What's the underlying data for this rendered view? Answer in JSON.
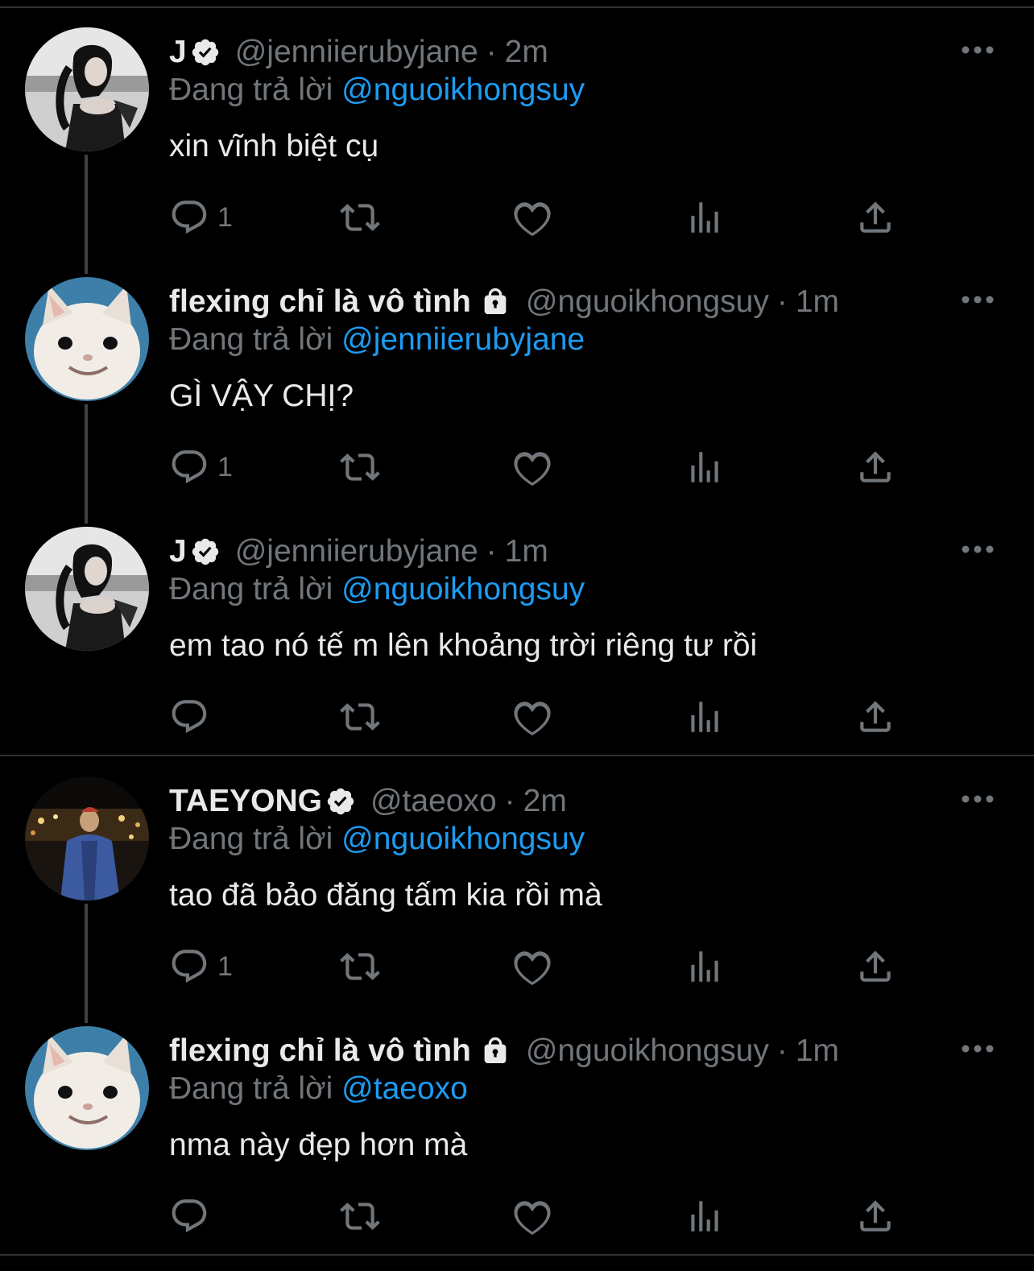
{
  "tweets": [
    {
      "name": "J",
      "verified": true,
      "locked": false,
      "handle": "@jenniierubyjane",
      "time": "2m",
      "reply_label": "Đang trả lời",
      "reply_to": "@nguoikhongsuy",
      "text": "xin vĩnh biệt cụ",
      "reply_count": "1",
      "avatar": "woman-bw-photo"
    },
    {
      "name": "flexing chỉ là vô tình",
      "verified": false,
      "locked": true,
      "handle": "@nguoikhongsuy",
      "time": "1m",
      "reply_label": "Đang trả lời",
      "reply_to": "@jenniierubyjane",
      "text": "GÌ VẬY CHỊ?",
      "reply_count": "1",
      "avatar": "cat-photo"
    },
    {
      "name": "J",
      "verified": true,
      "locked": false,
      "handle": "@jenniierubyjane",
      "time": "1m",
      "reply_label": "Đang trả lời",
      "reply_to": "@nguoikhongsuy",
      "text": "em tao nó tế m lên khoảng trời riêng tư rồi",
      "reply_count": "",
      "avatar": "woman-bw-photo"
    },
    {
      "name": "TAEYONG",
      "verified": true,
      "locked": false,
      "handle": "@taeoxo",
      "time": "2m",
      "reply_label": "Đang trả lời",
      "reply_to": "@nguoikhongsuy",
      "text": "tao đã bảo đăng tấm kia rồi mà",
      "reply_count": "1",
      "avatar": "night-person-photo"
    },
    {
      "name": "flexing chỉ là vô tình",
      "verified": false,
      "locked": true,
      "handle": "@nguoikhongsuy",
      "time": "1m",
      "reply_label": "Đang trả lời",
      "reply_to": "@taeoxo",
      "text": "nma này đẹp hơn mà",
      "reply_count": "",
      "avatar": "cat-photo"
    }
  ],
  "colors": {
    "background": "#000000",
    "text": "#e7e9ea",
    "muted": "#71767b",
    "link": "#1d9bf0",
    "divider": "#2f3336"
  },
  "icons": [
    "reply-icon",
    "retweet-icon",
    "like-icon",
    "views-icon",
    "share-icon",
    "more-icon",
    "verified-badge-icon",
    "lock-icon"
  ]
}
